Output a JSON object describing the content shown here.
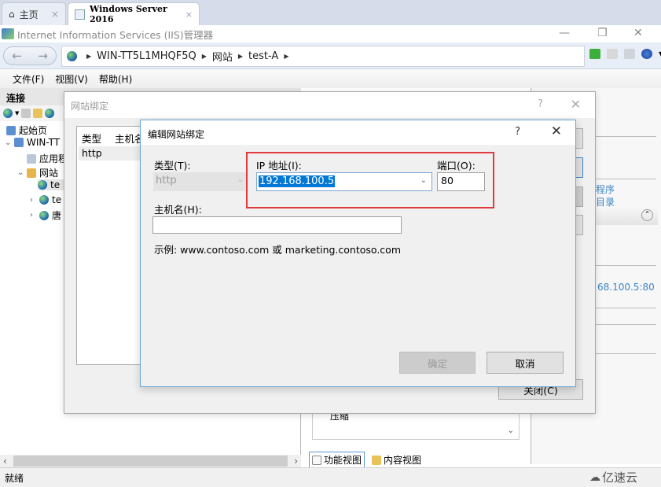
{
  "browser_tabs": [
    {
      "label": "主页",
      "icon": "home-icon",
      "close": "×"
    },
    {
      "label": "Windows Server 2016",
      "icon": "vm-icon",
      "close": "×"
    }
  ],
  "window": {
    "title": "Internet Information Services (IIS)管理器",
    "minimize": "—",
    "restore": "❐",
    "close": "✕"
  },
  "address_bar": {
    "back": "←",
    "forward": "→",
    "breadcrumb": [
      "WIN-TT5L1MHQF5Q",
      "网站",
      "test-A"
    ],
    "separator": "▶"
  },
  "menu": [
    "文件(F)",
    "视图(V)",
    "帮助(H)"
  ],
  "connections": {
    "header": "连接",
    "tree": [
      {
        "label": "起始页",
        "level": 0
      },
      {
        "label": "WIN-TT",
        "level": 0,
        "expanded": true
      },
      {
        "label": "应用程",
        "level": 1
      },
      {
        "label": "网站",
        "level": 1,
        "expanded": true
      },
      {
        "label": "te",
        "level": 2,
        "selected": true
      },
      {
        "label": "te",
        "level": 2
      },
      {
        "label": "唐",
        "level": 2
      }
    ]
  },
  "center": {
    "list_item": "压缩",
    "view_tabs": [
      "功能视图",
      "内容视图"
    ]
  },
  "actions_panel": {
    "links": [
      "程序",
      "目录"
    ],
    "binding_text": "68.100.5:80"
  },
  "site_bindings_dialog": {
    "title": "网站绑定",
    "help": "?",
    "close": "✕",
    "columns": [
      "类型",
      "主机名"
    ],
    "rows": [
      {
        "type": "http"
      }
    ],
    "close_button": "关闭(C)"
  },
  "edit_binding_dialog": {
    "title": "编辑网站绑定",
    "help": "?",
    "close": "✕",
    "type_label": "类型(T):",
    "type_value": "http",
    "ip_label": "IP 地址(I):",
    "ip_value": "192.168.100.5",
    "port_label": "端口(O):",
    "port_value": "80",
    "host_label": "主机名(H):",
    "host_value": "",
    "example": "示例: www.contoso.com 或 marketing.contoso.com",
    "ok": "确定",
    "cancel": "取消",
    "highlight_color": "#e0393e"
  },
  "status": "就绪",
  "watermark": "亿速云"
}
